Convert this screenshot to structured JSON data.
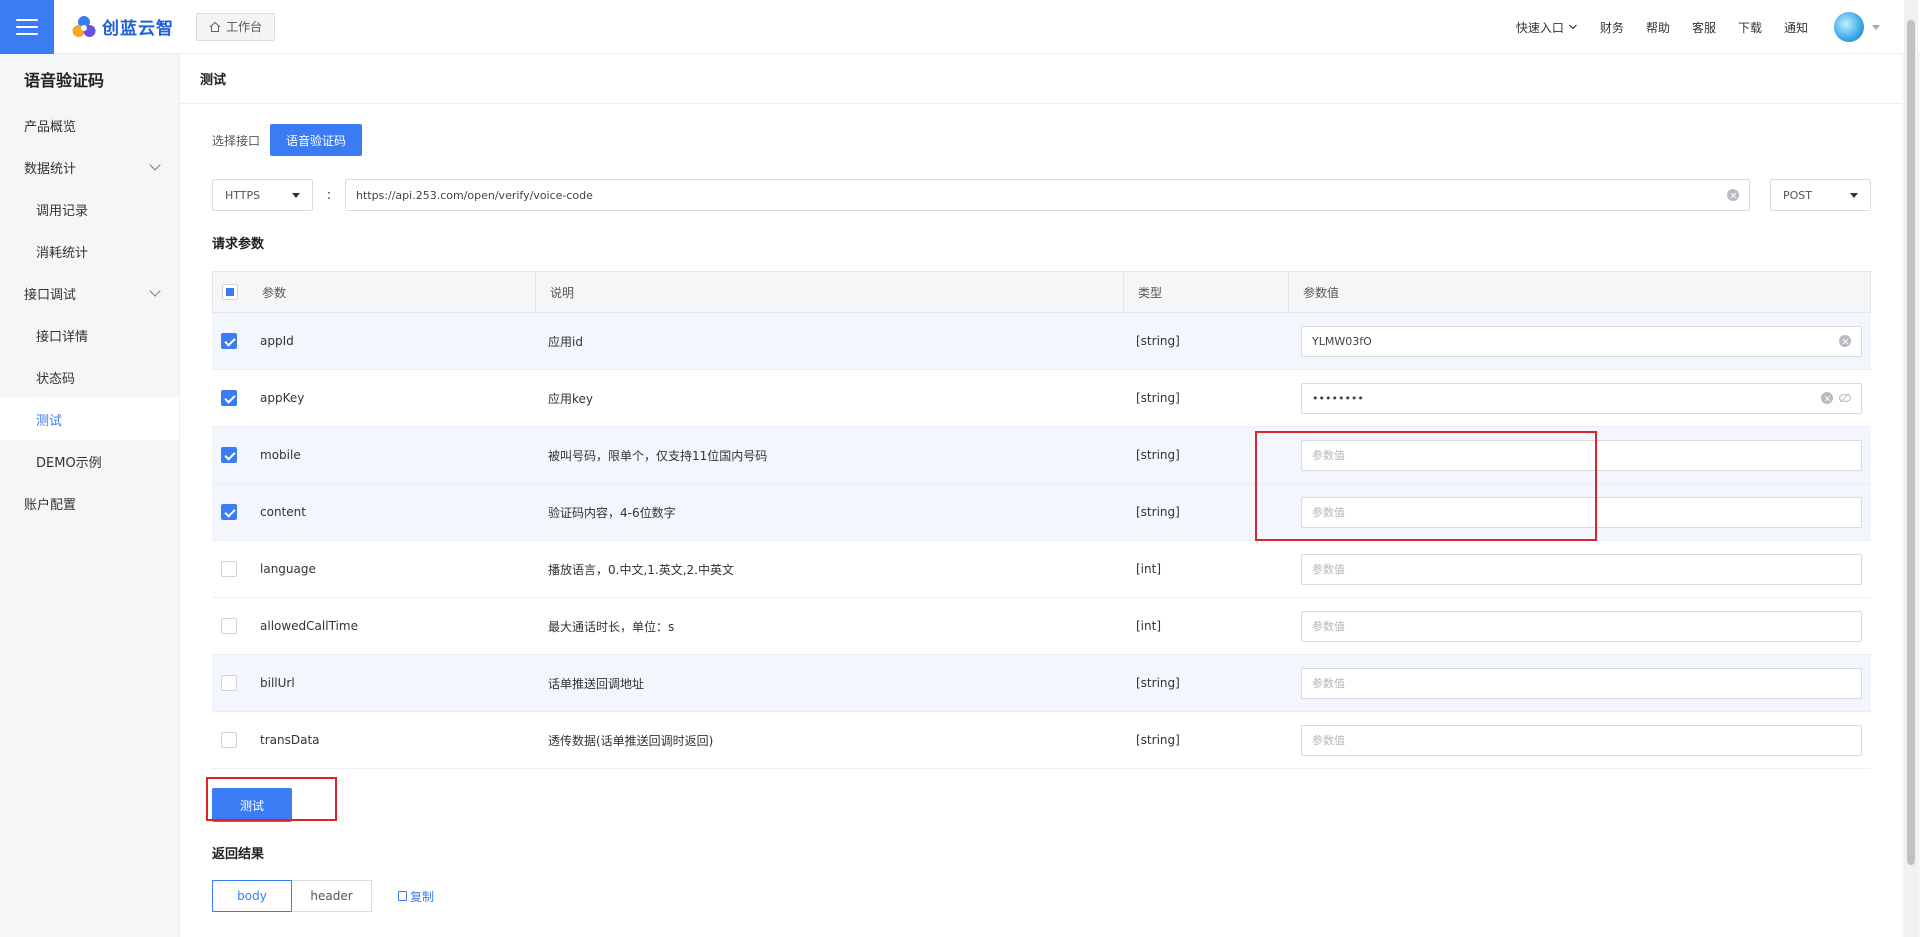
{
  "header": {
    "logo_text": "创蓝云智",
    "workbench_label": "工作台",
    "links": {
      "quick_entry": "快速入口",
      "finance": "财务",
      "help": "帮助",
      "service": "客服",
      "download": "下载",
      "notify": "通知"
    }
  },
  "sidebar": {
    "title": "语音验证码",
    "items": [
      {
        "label": "产品概览"
      },
      {
        "label": "数据统计"
      },
      {
        "label": "调用记录"
      },
      {
        "label": "消耗统计"
      },
      {
        "label": "接口调试"
      },
      {
        "label": "接口详情"
      },
      {
        "label": "状态码"
      },
      {
        "label": "测试"
      },
      {
        "label": "DEMO示例"
      },
      {
        "label": "账户配置"
      }
    ]
  },
  "main": {
    "page_title": "测试",
    "interface_label": "选择接口",
    "interface_button": "语音验证码",
    "protocol": "HTTPS",
    "colon": ":",
    "url": "https://api.253.com/open/verify/voice-code",
    "method": "POST",
    "request_params_title": "请求参数",
    "table_headers": {
      "param": "参数",
      "desc": "说明",
      "type": "类型",
      "value": "参数值"
    },
    "value_placeholder": "参数值",
    "rows": [
      {
        "param": "appId",
        "desc": "应用id",
        "type": "[string]",
        "value": "YLMW03fO"
      },
      {
        "param": "appKey",
        "desc": "应用key",
        "type": "[string]",
        "value": "••••••••"
      },
      {
        "param": "mobile",
        "desc": "被叫号码，限单个，仅支持11位国内号码",
        "type": "[string]"
      },
      {
        "param": "content",
        "desc": "验证码内容，4-6位数字",
        "type": "[string]"
      },
      {
        "param": "language",
        "desc": "播放语言，0.中文,1.英文,2.中英文",
        "type": "[int]"
      },
      {
        "param": "allowedCallTime",
        "desc": "最大通话时长，单位：s",
        "type": "[int]"
      },
      {
        "param": "billUrl",
        "desc": "话单推送回调地址",
        "type": "[string]"
      },
      {
        "param": "transData",
        "desc": "透传数据(话单推送回调时返回)",
        "type": "[string]"
      }
    ],
    "test_button": "测试",
    "result_title": "返回结果",
    "result_tabs": [
      "body",
      "header"
    ],
    "copy_label": "复制"
  },
  "colors": {
    "accent": "#3b7cf5",
    "highlight_box": "#e0222a"
  }
}
